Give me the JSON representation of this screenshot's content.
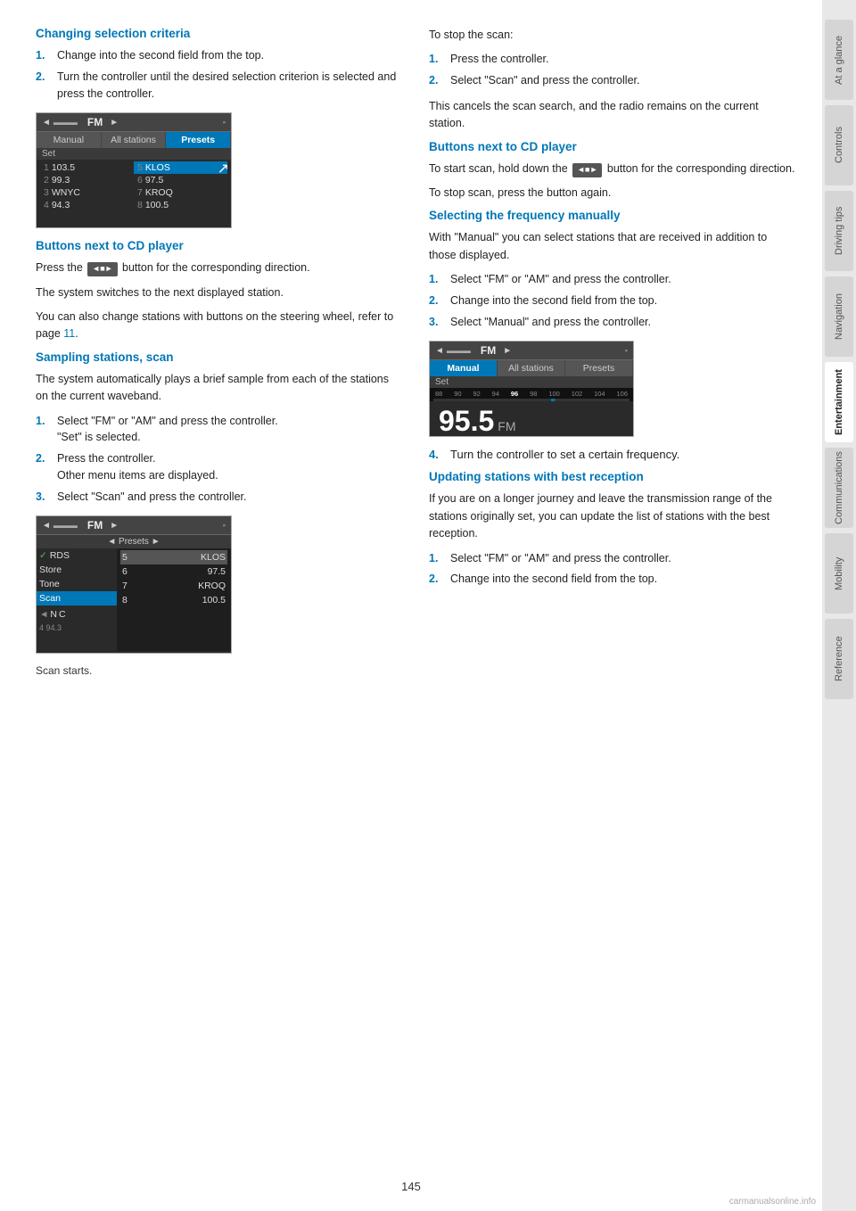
{
  "sidebar": {
    "tabs": [
      {
        "label": "At a glance",
        "active": false
      },
      {
        "label": "Controls",
        "active": false
      },
      {
        "label": "Driving tips",
        "active": false
      },
      {
        "label": "Navigation",
        "active": false
      },
      {
        "label": "Entertainment",
        "active": true
      },
      {
        "label": "Communications",
        "active": false
      },
      {
        "label": "Mobility",
        "active": false
      },
      {
        "label": "Reference",
        "active": false
      }
    ]
  },
  "page_number": "145",
  "sections": {
    "left": {
      "changing_selection": {
        "heading": "Changing selection criteria",
        "steps": [
          "Change into the second field from the top.",
          "Turn the controller until the desired selection criterion is selected and press the controller."
        ],
        "screen1": {
          "header": "FM",
          "tabs": [
            "Manual",
            "All stations",
            "Presets"
          ],
          "active_tab": 2,
          "set_row": "Set",
          "stations": [
            {
              "num": "1",
              "name": "103.5",
              "col2_num": "5",
              "col2_name": "KLOS"
            },
            {
              "num": "2",
              "name": "99.3",
              "col2_num": "6",
              "col2_name": "97.5"
            },
            {
              "num": "3",
              "name": "WNYC",
              "col2_num": "7",
              "col2_name": "KROQ"
            },
            {
              "num": "4",
              "name": "94.3",
              "col2_num": "8",
              "col2_name": "100.5"
            }
          ]
        }
      },
      "buttons_cd_1": {
        "heading": "Buttons next to CD player",
        "para1": "Press the button for the corresponding direction.",
        "para2": "The system switches to the next displayed station.",
        "para3": "You can also change stations with buttons on the steering wheel, refer to page 11."
      },
      "sampling": {
        "heading": "Sampling stations, scan",
        "intro": "The system automatically plays a brief sample from each of the stations on the current waveband.",
        "steps": [
          {
            "text": "Select \"FM\" or \"AM\" and press the controller.\n\"Set\" is selected."
          },
          {
            "text": "Press the controller.\nOther menu items are displayed."
          },
          {
            "text": "Select \"Scan\" and press the controller."
          }
        ],
        "screen2": {
          "header": "FM",
          "presets_row": "◄ Presets ►",
          "menu_items": [
            "✓ RDS",
            "Store",
            "Tone",
            "Scan"
          ],
          "active_menu": 3,
          "right_stations": [
            {
              "name": "5 KLOS"
            },
            {
              "name": "6 97.5"
            },
            {
              "name": "7 KROQ"
            },
            {
              "name": "8 100.5"
            }
          ],
          "right_active": 0,
          "left_station": "N C",
          "left_num": "4 94.3"
        },
        "caption": "Scan starts."
      }
    },
    "right": {
      "stop_scan": {
        "heading": "To stop the scan:",
        "steps": [
          "Press the controller.",
          "Select \"Scan\" and press the controller."
        ],
        "note": "This cancels the scan search, and the radio remains on the current station."
      },
      "buttons_cd_2": {
        "heading": "Buttons next to CD player",
        "para1": "To start scan, hold down the button for the corresponding direction.",
        "para2": "To stop scan, press the button again."
      },
      "selecting_frequency": {
        "heading": "Selecting the frequency manually",
        "intro": "With \"Manual\" you can select stations that are received in addition to those displayed.",
        "steps": [
          "Select \"FM\" or \"AM\" and press the controller.",
          "Change into the second field from the top.",
          "Select \"Manual\" and press the controller."
        ],
        "screen3": {
          "header": "FM",
          "tabs": [
            "Manual",
            "All stations",
            "Presets"
          ],
          "active_tab": 0,
          "set_row": "Set",
          "freq_numbers": [
            "88",
            "90",
            "92",
            "94",
            "96",
            "98",
            "100",
            "102",
            "104",
            "106"
          ],
          "big_freq": "95.5",
          "fm_label": "FM"
        },
        "step4": "Turn the controller to set a certain frequency."
      },
      "updating_stations": {
        "heading": "Updating stations with best reception",
        "intro": "If you are on a longer journey and leave the transmission range of the stations originally set, you can update the list of stations with the best reception.",
        "steps": [
          "Select \"FM\" or \"AM\" and press the controller.",
          "Change into the second field from the top."
        ]
      }
    }
  },
  "watermark": "carmanualsonline.info"
}
